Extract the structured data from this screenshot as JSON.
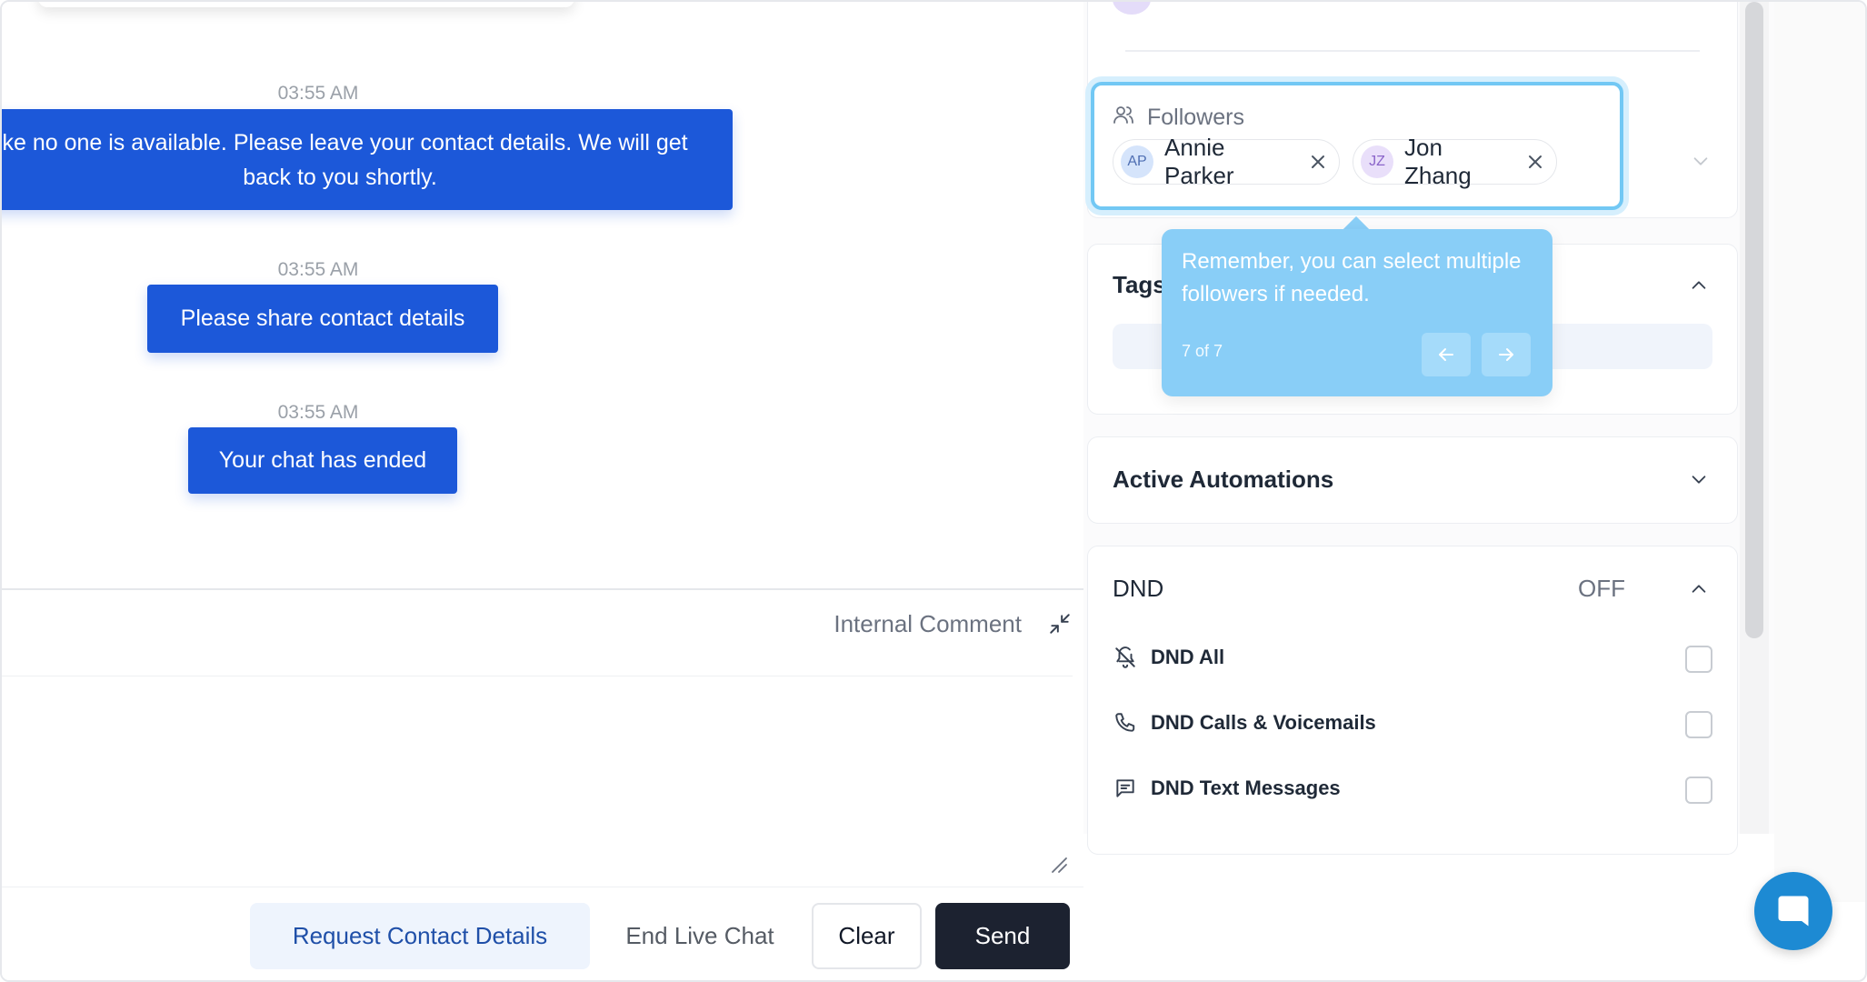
{
  "chat": {
    "messages": [
      {
        "time": "03:55 AM",
        "text": "like no one is available. Please leave your contact details. We will get back to you shortly."
      },
      {
        "time": "03:55 AM",
        "text": "Please share contact details"
      },
      {
        "time": "03:55 AM",
        "text": "Your chat has ended"
      }
    ]
  },
  "composer": {
    "internal_comment_label": "Internal Comment",
    "buttons": {
      "request_contact": "Request Contact Details",
      "end_live_chat": "End Live Chat",
      "clear": "Clear",
      "send": "Send"
    }
  },
  "sidebar": {
    "followers": {
      "label": "Followers",
      "chips": [
        {
          "initials": "AP",
          "name": "Annie Parker"
        },
        {
          "initials": "JZ",
          "name": "Jon Zhang"
        }
      ]
    },
    "tags": {
      "label": "Tags"
    },
    "active_automations": {
      "label": "Active Automations"
    },
    "dnd": {
      "label": "DND",
      "status": "OFF",
      "options": [
        {
          "label": "DND All",
          "icon": "bell-off-icon",
          "checked": false
        },
        {
          "label": "DND Calls & Voicemails",
          "icon": "phone-icon",
          "checked": false
        },
        {
          "label": "DND Text Messages",
          "icon": "message-icon",
          "checked": false
        }
      ]
    }
  },
  "tooltip": {
    "text": "Remember, you can select multiple followers if needed.",
    "step": "7 of 7"
  },
  "colors": {
    "bubble": "#1c58d9",
    "send": "#1c2230",
    "tooltip": "#89cef7",
    "focus_ring": "#72c8f4",
    "widget": "#1d8ad3"
  }
}
